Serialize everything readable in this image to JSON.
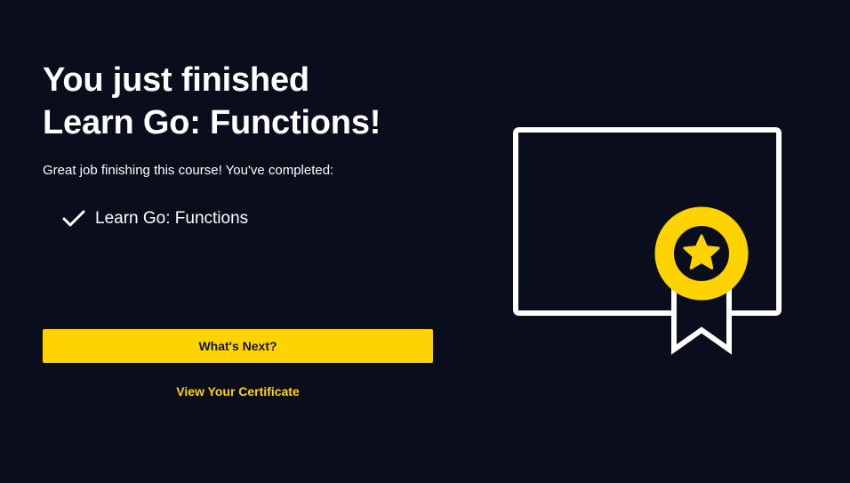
{
  "headline": {
    "line1": "You just finished",
    "line2": "Learn Go: Functions!"
  },
  "subtext": "Great job finishing this course! You've completed:",
  "completed_items": [
    {
      "label": "Learn Go: Functions",
      "icon": "check-icon"
    }
  ],
  "actions": {
    "primary_label": "What's Next?",
    "certificate_link": "View Your Certificate"
  },
  "illustration": {
    "icon": "certificate-icon",
    "badge_icon": "star-icon"
  },
  "colors": {
    "background": "#0a0d1c",
    "accent": "#ffd300",
    "text": "#ffffff",
    "button_text": "#10162f"
  }
}
